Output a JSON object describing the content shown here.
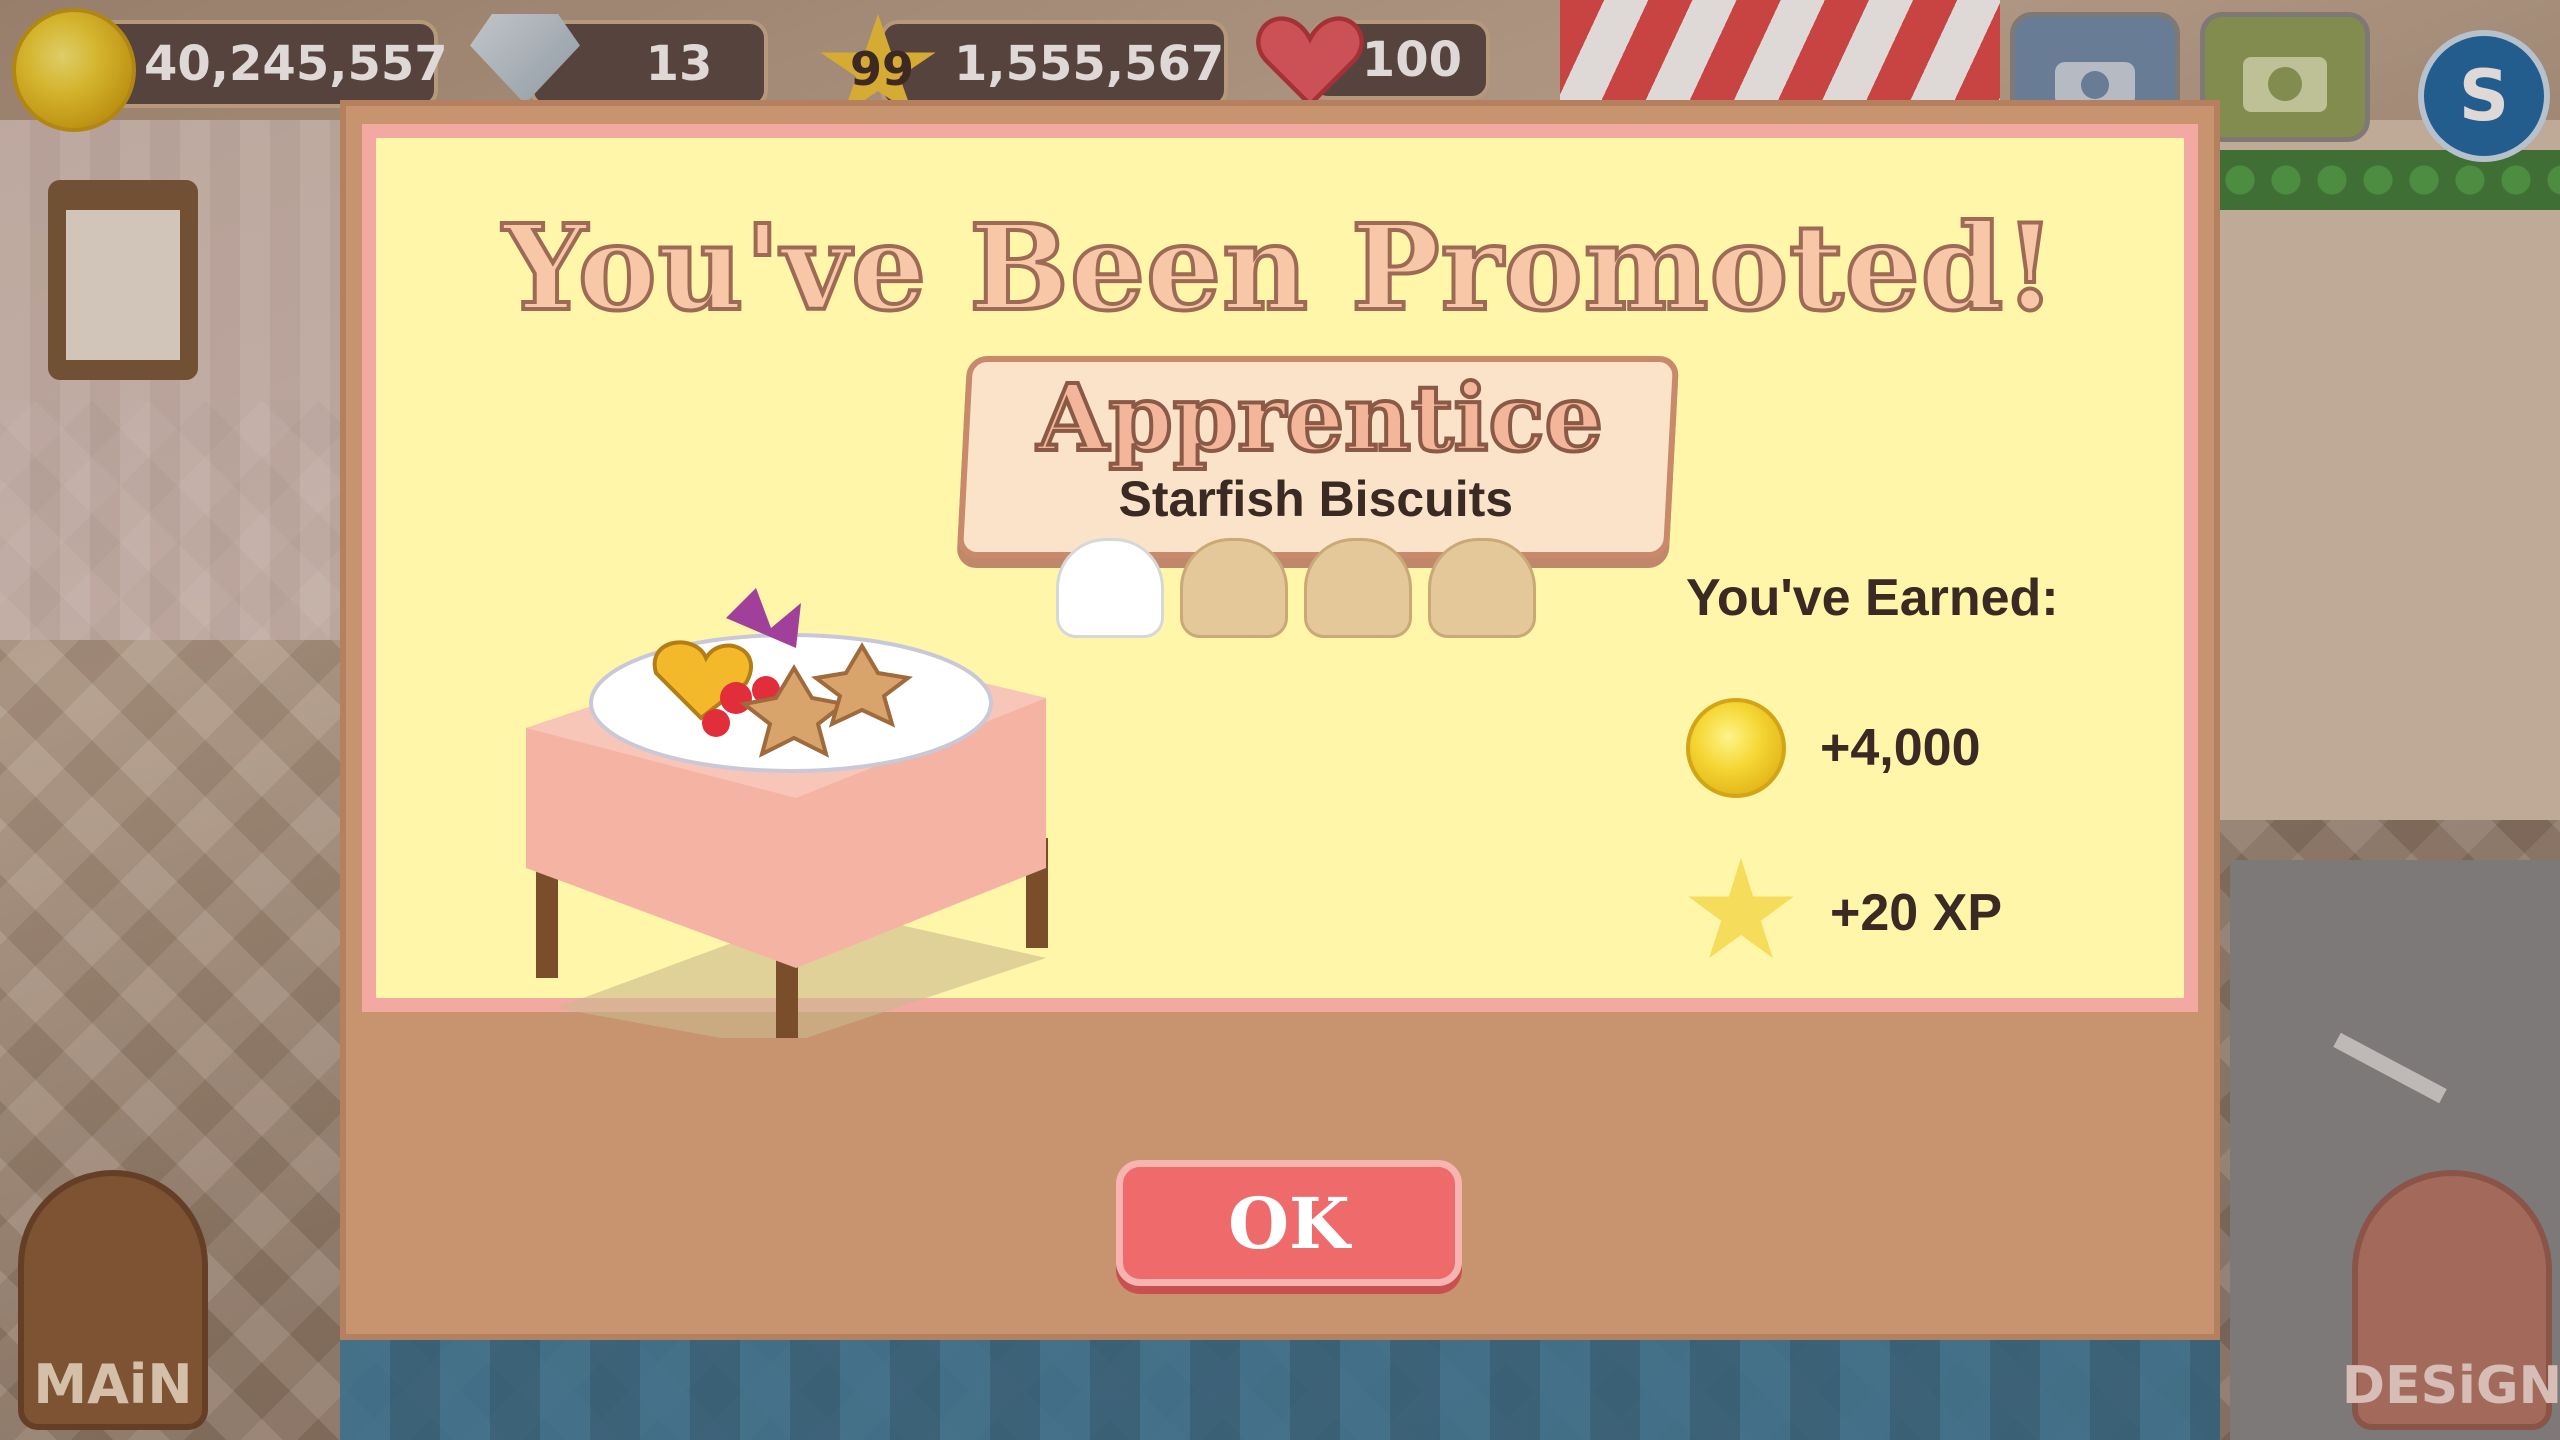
{
  "hud": {
    "coins": "40,245,557",
    "diamonds": "13",
    "level": "99",
    "xp": "1,555,567",
    "hearts": "100",
    "currency_symbol": "S"
  },
  "side_buttons": {
    "main_label": "MAiN",
    "design_label": "DESiGN"
  },
  "dialog": {
    "title": "You've Been Promoted!",
    "rank": "Apprentice",
    "item": "Starfish Biscuits",
    "mastery": {
      "filled": 1,
      "total": 4
    },
    "earned_label": "You've Earned:",
    "rewards": [
      {
        "icon": "coin-icon",
        "text": "+4,000"
      },
      {
        "icon": "star-icon",
        "text": "+20 XP"
      }
    ],
    "ok_label": "OK"
  },
  "colors": {
    "dialog_bg": "#fff6a9",
    "dialog_border": "#f2a9a2",
    "panel": "#c89470",
    "ok_button": "#ee6a6b"
  }
}
